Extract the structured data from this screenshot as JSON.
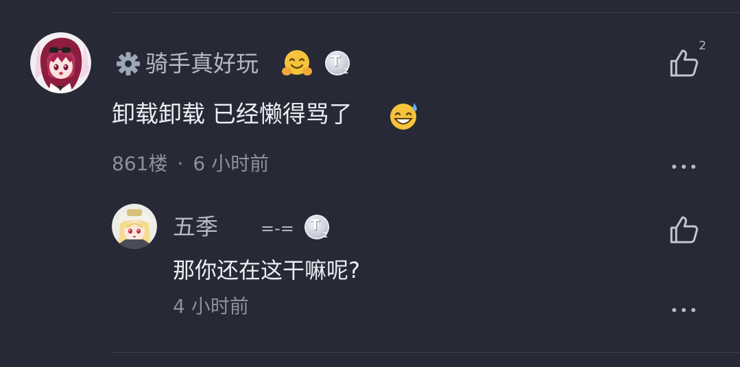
{
  "comment": {
    "username": "骑手真好玩",
    "text": "卸载卸载 已经懒得骂了",
    "floor": "861楼",
    "separator": "·",
    "time": "6 小时前",
    "like_count": "2",
    "level_badge": {
      "letter": "T",
      "number": "2"
    },
    "emoji_name": "hug-emoji",
    "text_emoji": "sweat-smile-emoji"
  },
  "reply": {
    "username": "五季",
    "signature": "=-=",
    "text": "那你还在这干嘛呢?",
    "time": "4 小时前",
    "level_badge": {
      "letter": "T",
      "number": "2"
    }
  },
  "colors": {
    "background": "#272a36",
    "divider": "#3c404d",
    "text": "#eceef3",
    "muted": "#8d919c",
    "icon": "#b5b9c4"
  }
}
